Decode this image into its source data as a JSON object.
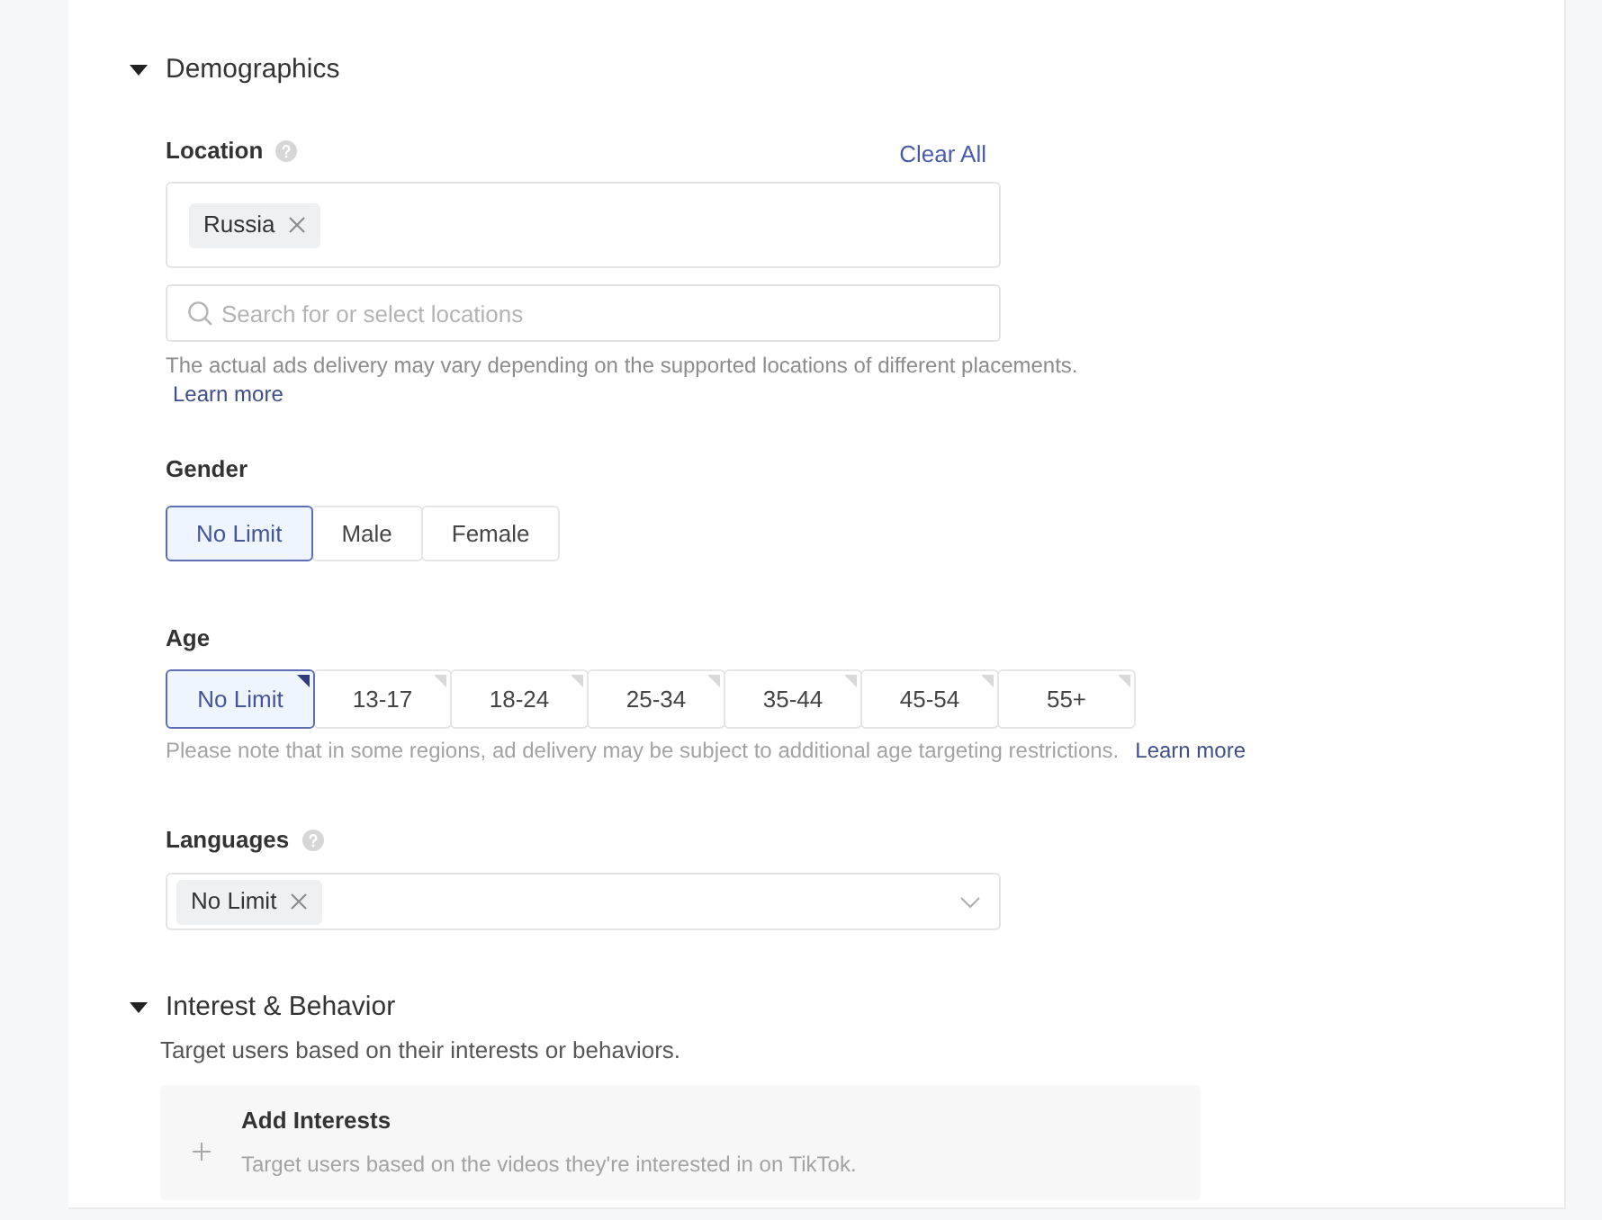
{
  "demographics": {
    "title": "Demographics",
    "expanded": true,
    "location": {
      "label": "Location",
      "clear_all": "Clear All",
      "tags": [
        {
          "label": "Russia"
        }
      ],
      "search": {
        "placeholder": "Search for or select locations"
      },
      "hint": "The actual ads delivery may vary depending on the supported locations of different placements.",
      "learn_more": "Learn more"
    },
    "gender": {
      "label": "Gender",
      "options": [
        {
          "label": "No Limit",
          "selected": true
        },
        {
          "label": "Male",
          "selected": false
        },
        {
          "label": "Female",
          "selected": false
        }
      ]
    },
    "age": {
      "label": "Age",
      "options": [
        {
          "label": "No Limit",
          "selected": true
        },
        {
          "label": "13-17",
          "selected": false
        },
        {
          "label": "18-24",
          "selected": false
        },
        {
          "label": "25-34",
          "selected": false
        },
        {
          "label": "35-44",
          "selected": false
        },
        {
          "label": "45-54",
          "selected": false
        },
        {
          "label": "55+",
          "selected": false
        }
      ],
      "note": "Please note that in some regions, ad delivery may be subject to additional age targeting restrictions.",
      "learn_more": "Learn more"
    },
    "languages": {
      "label": "Languages",
      "tags": [
        {
          "label": "No Limit"
        }
      ]
    }
  },
  "interest_behavior": {
    "title": "Interest & Behavior",
    "expanded": true,
    "description": "Target users based on their interests or behaviors.",
    "add_card": {
      "title": "Add Interests",
      "description": "Target users based on the videos they're interested in on TikTok."
    }
  }
}
